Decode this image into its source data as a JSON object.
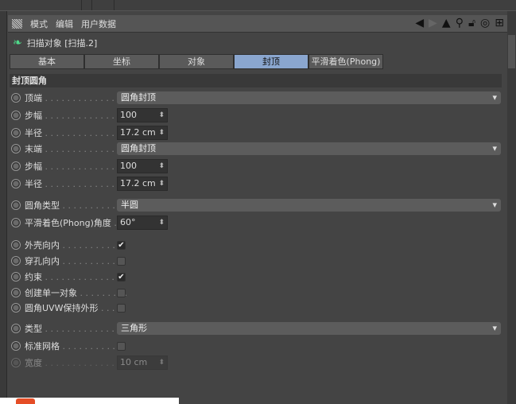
{
  "menu": {
    "items": [
      "模式",
      "编辑",
      "用户数据"
    ]
  },
  "header": {
    "title": "扫描对象 [扫描.2]"
  },
  "tabs": [
    "基本",
    "坐标",
    "对象",
    "封顶",
    "平滑着色(Phong)"
  ],
  "active_tab": "封顶",
  "section": "封顶圆角",
  "fields": {
    "top": {
      "label": "顶端",
      "value": "圆角封顶"
    },
    "top_steps": {
      "label": "步幅",
      "value": "100"
    },
    "top_radius": {
      "label": "半径",
      "value": "17.2 cm"
    },
    "end": {
      "label": "末端",
      "value": "圆角封顶"
    },
    "end_steps": {
      "label": "步幅",
      "value": "100"
    },
    "end_radius": {
      "label": "半径",
      "value": "17.2 cm"
    },
    "fillet_type": {
      "label": "圆角类型",
      "value": "半圆"
    },
    "phong_angle": {
      "label": "平滑着色(Phong)角度",
      "value": "60°"
    },
    "hull_inwards": {
      "label": "外壳向内",
      "checked": true
    },
    "hole_inwards": {
      "label": "穿孔向内",
      "checked": false
    },
    "constrain": {
      "label": "约束",
      "checked": true
    },
    "single_object": {
      "label": "创建单一对象",
      "checked": false
    },
    "keep_uvw": {
      "label": "圆角UVW保持外形",
      "checked": false
    },
    "type": {
      "label": "类型",
      "value": "三角形"
    },
    "regular_grid": {
      "label": "标准网格",
      "checked": false
    },
    "width": {
      "label": "宽度",
      "value": "10 cm"
    }
  }
}
